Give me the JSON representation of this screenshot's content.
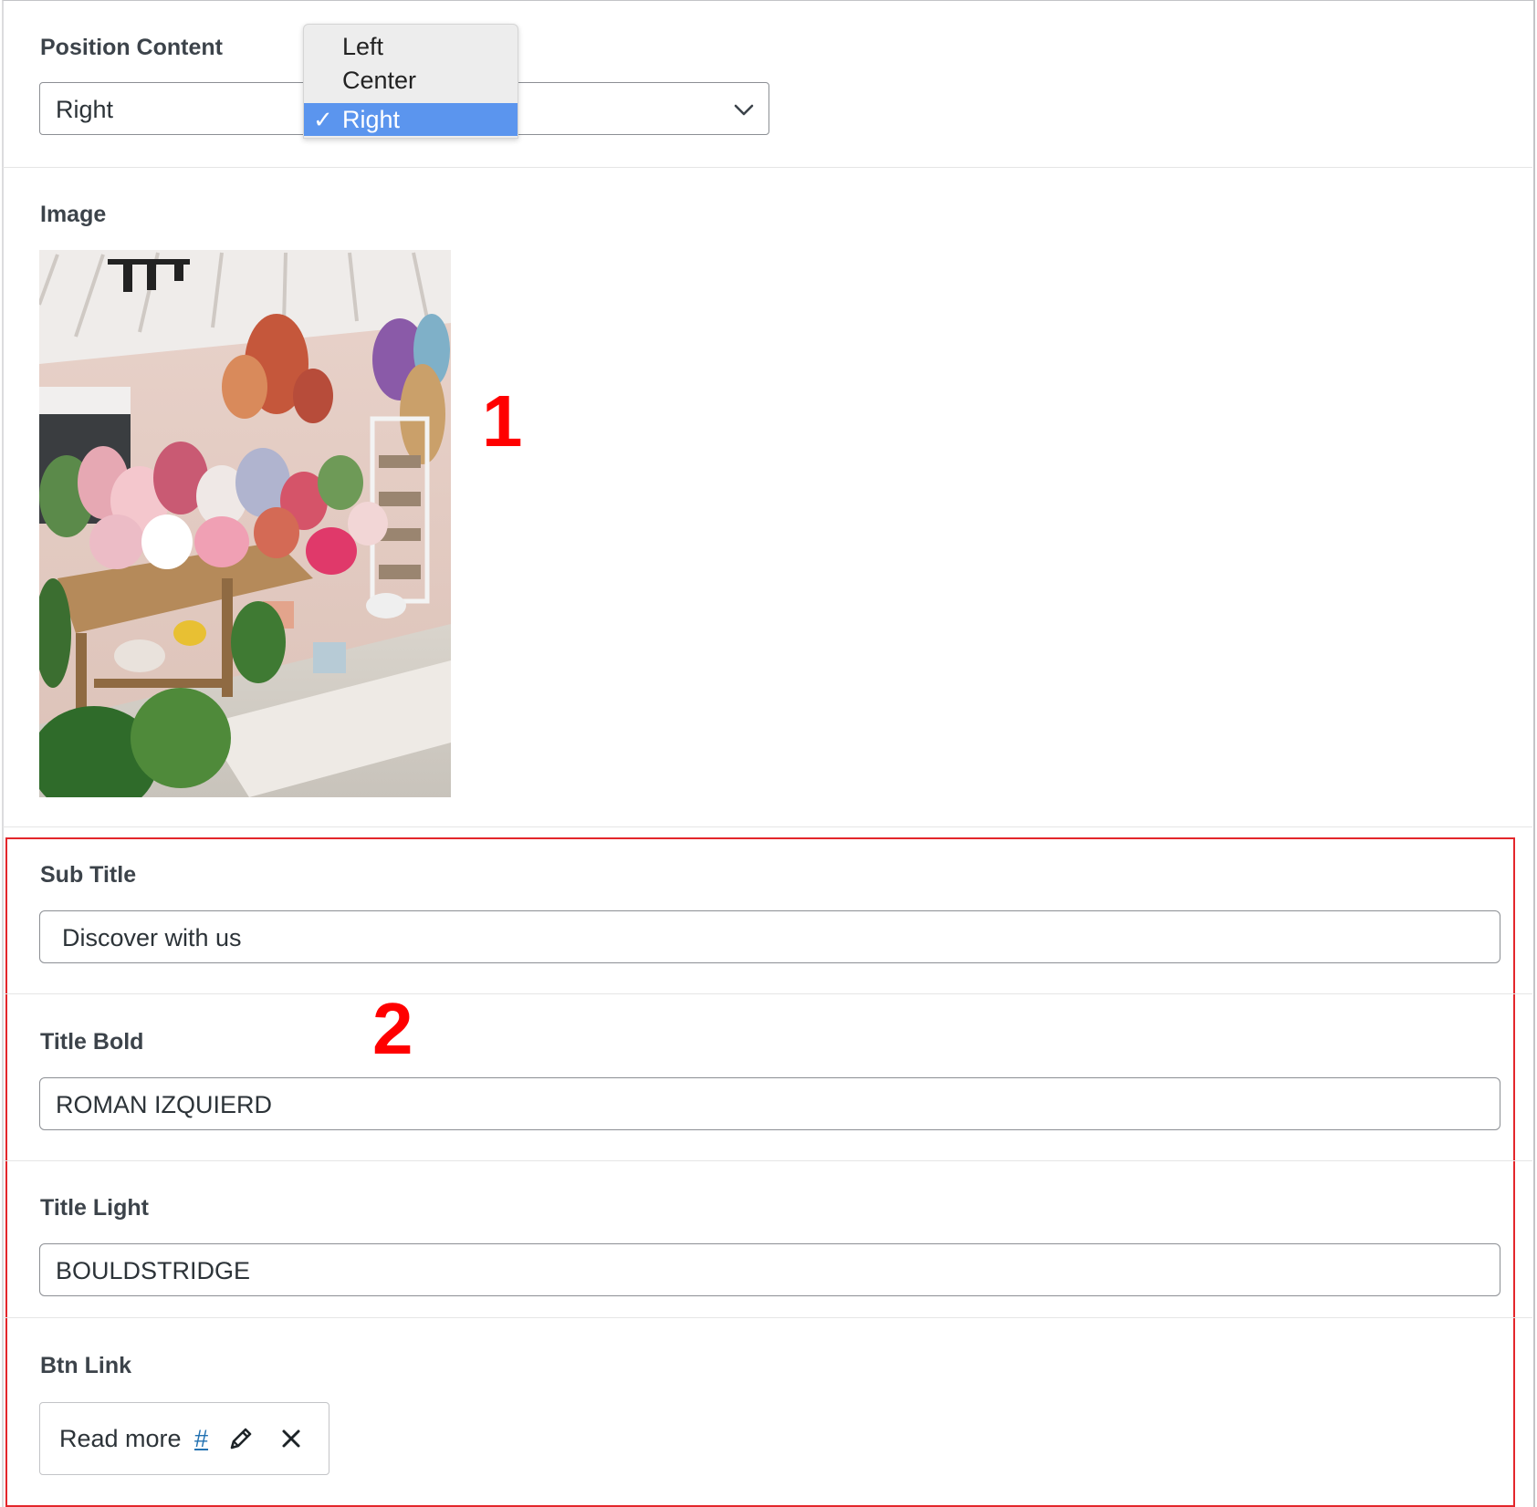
{
  "position_content": {
    "label": "Position Content",
    "selected_value": "Right",
    "options": [
      {
        "label": "Left",
        "selected": false
      },
      {
        "label": "Center",
        "selected": false
      },
      {
        "label": "Right",
        "selected": true
      }
    ],
    "check_mark": "✓"
  },
  "image_field": {
    "label": "Image"
  },
  "annotations": {
    "marker_1": "1",
    "marker_2": "2",
    "color": "#ff0000"
  },
  "sub_title": {
    "label": "Sub Title",
    "value": "Discover with us"
  },
  "title_bold": {
    "label": "Title Bold",
    "value": "ROMAN IZQUIERD"
  },
  "title_light": {
    "label": "Title Light",
    "value": "BOULDSTRIDGE"
  },
  "btn_link": {
    "label": "Btn Link",
    "text": "Read more",
    "url": "#",
    "edit_icon": "pencil-icon",
    "remove_icon": "close-icon"
  },
  "colors": {
    "selected_option": "#5b95ee",
    "link": "#2271b1",
    "highlight_border": "#e3262b"
  }
}
